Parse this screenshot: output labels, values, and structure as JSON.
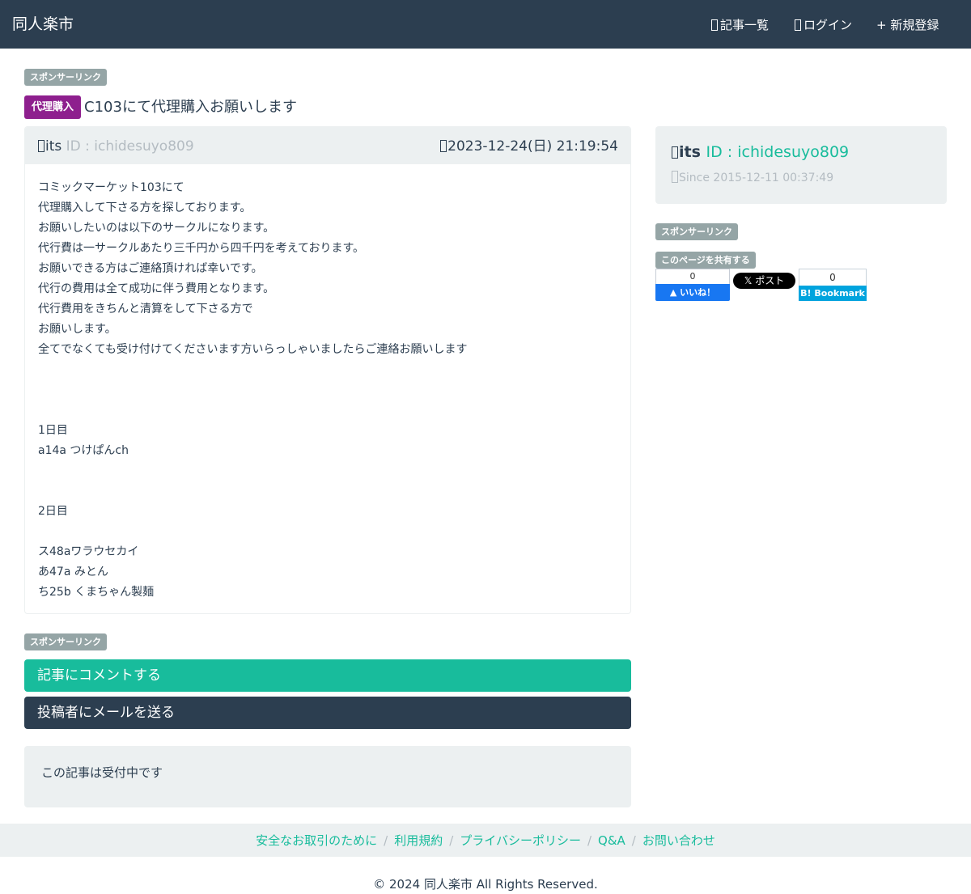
{
  "navbar": {
    "brand": "同人楽市",
    "items": [
      {
        "label": "記事一覧"
      },
      {
        "label": "ログイン"
      },
      {
        "label": "+ 新規登録"
      }
    ]
  },
  "sponsor_label": "スポンサーリンク",
  "post": {
    "category": "代理購入",
    "title": "C103にて代理購入お願いします",
    "author_name": "its",
    "author_id": "ID : ichidesuyo809",
    "posted_at": "2023-12-24(日) 21:19:54",
    "body_lines": [
      "コミックマーケット103にて",
      "代理購入して下さる方を探しております。",
      "お願いしたいのは以下のサークルになります。",
      "代行費は一サークルあたり三千円から四千円を考えております。",
      "お願いできる方はご連絡頂ければ幸いです。",
      "代行の費用は全て成功に伴う費用となります。",
      "代行費用をきちんと清算をして下さる方で",
      "お願いします。",
      "全てでなくても受け付けてくださいます方いらっしゃいましたらご連絡お願いします",
      "",
      "",
      "",
      "1日目",
      "a14a つけぱんch",
      "",
      "",
      "2日目",
      "",
      "ス48aワラウセカイ",
      "あ47a みとん",
      "ち25b くまちゃん製麺"
    ]
  },
  "actions": {
    "comment": "記事にコメントする",
    "mail": "投稿者にメールを送る"
  },
  "status": "この記事は受付中です",
  "profile": {
    "name": "its",
    "id": "ID : ichidesuyo809",
    "since": "Since 2015-12-11 00:37:49"
  },
  "share": {
    "label": "このページを共有する",
    "fb_count": "0",
    "fb_label": "いいね！",
    "x_label": "ポスト",
    "hatena_count": "0",
    "hatena_label": "B! Bookmark"
  },
  "footer": {
    "links": [
      "安全なお取引のために",
      "利用規約",
      "プライバシーポリシー",
      "Q&A",
      "お問い合わせ"
    ],
    "copyright": "© 2024 同人楽市 All Rights Reserved."
  },
  "colors": {
    "navbar": "#2c3e50",
    "accent": "#18bc9c",
    "category_badge": "#8e1f8e",
    "label_gray": "#95a5a6",
    "well": "#ecf0f1"
  }
}
